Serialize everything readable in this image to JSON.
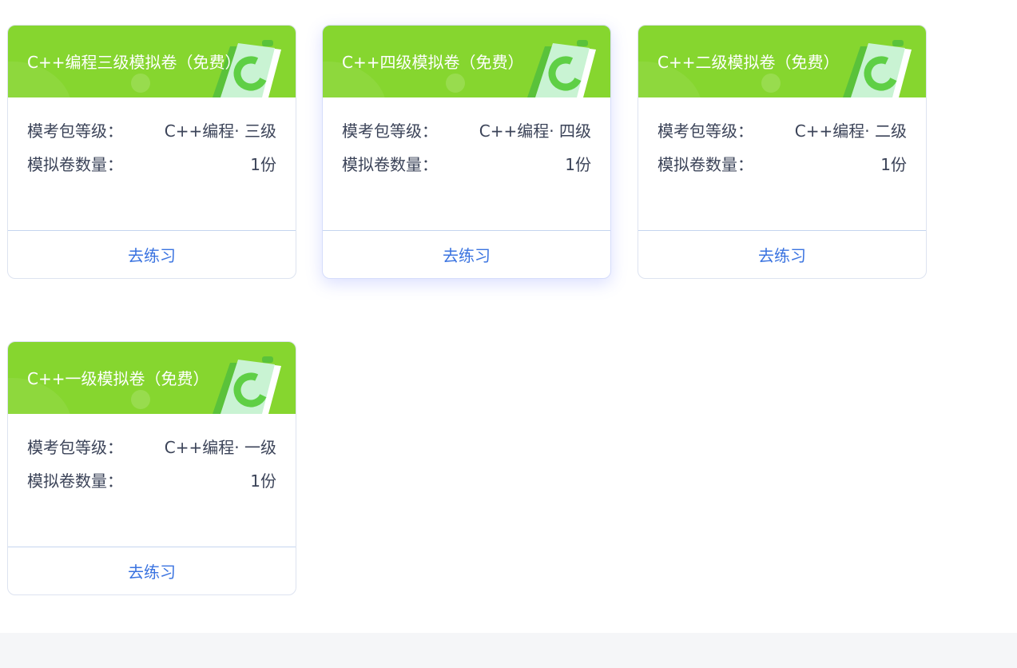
{
  "cards": [
    {
      "title": "C++编程三级模拟卷（免费）",
      "level_label": "模考包等级：",
      "level_value": "C++编程· 三级",
      "count_label": "模拟卷数量：",
      "count_value": "1份",
      "action": "去练习"
    },
    {
      "title": "C++四级模拟卷（免费）",
      "level_label": "模考包等级：",
      "level_value": "C++编程· 四级",
      "count_label": "模拟卷数量：",
      "count_value": "1份",
      "action": "去练习"
    },
    {
      "title": "C++二级模拟卷（免费）",
      "level_label": "模考包等级：",
      "level_value": "C++编程· 二级",
      "count_label": "模拟卷数量：",
      "count_value": "1份",
      "action": "去练习"
    },
    {
      "title": "C++一级模拟卷（免费）",
      "level_label": "模考包等级：",
      "level_value": "C++编程· 一级",
      "count_label": "模拟卷数量：",
      "count_value": "1份",
      "action": "去练习"
    }
  ],
  "icons": {
    "card_header_icon": "c-book-icon"
  },
  "colors": {
    "header_green": "#86d62f",
    "link_blue": "#3a73e0",
    "text_dark": "#3b4358",
    "book_light": "#c9f3d3",
    "book_dark_green": "#5ac23a"
  }
}
